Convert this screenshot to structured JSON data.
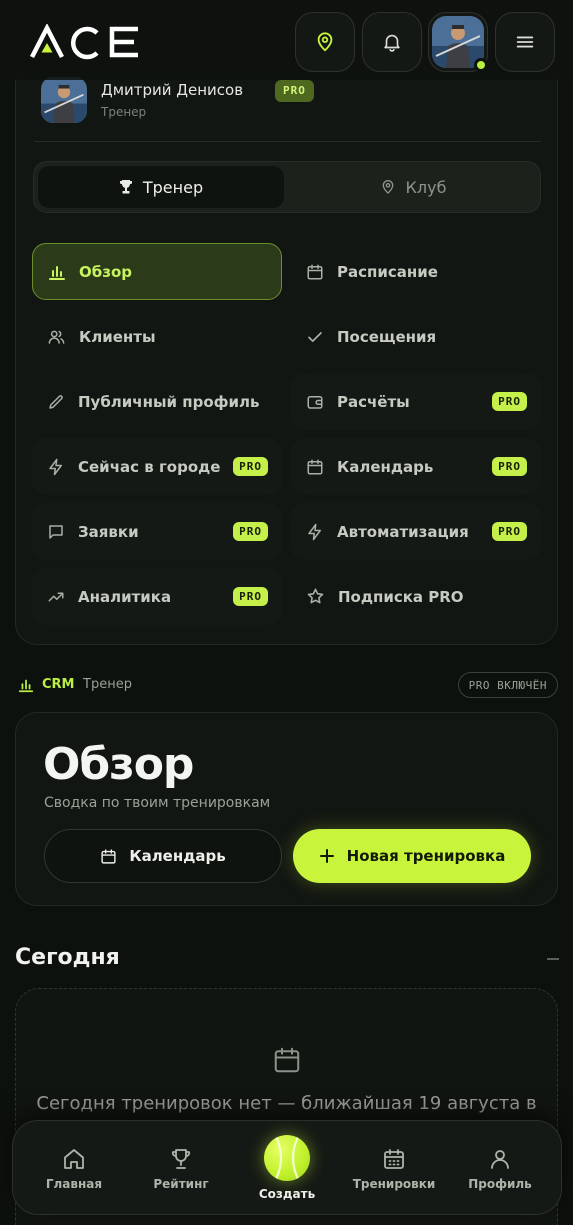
{
  "app": {
    "logo": "ACE"
  },
  "colors": {
    "accent": "#c8f53c",
    "background": "#0d110d",
    "card": "#121612"
  },
  "header": {
    "icons": [
      "location-icon",
      "bell-icon",
      "avatar",
      "menu-icon"
    ]
  },
  "profile": {
    "name": "Дмитрий Денисов",
    "badge": "PRO",
    "role": "Тренер"
  },
  "segment": {
    "trainer_label": "Тренер",
    "club_label": "Клуб"
  },
  "nav": {
    "overview": "Обзор",
    "schedule": "Расписание",
    "clients": "Клиенты",
    "visits": "Посещения",
    "public_profile": "Публичный профиль",
    "payments": "Расчёты",
    "city_now": "Сейчас в городе",
    "calendar": "Календарь",
    "requests": "Заявки",
    "automation": "Автоматизация",
    "analytics": "Аналитика",
    "subscription": "Подписка PRO",
    "pro": "PRO"
  },
  "crm": {
    "label": "CRM",
    "role": "Тренер",
    "pro_status": "PRO ВКЛЮЧЁН"
  },
  "overview": {
    "title": "Обзор",
    "subtitle": "Сводка по твоим тренировкам",
    "calendar_button": "Календарь",
    "new_button": "Новая тренировка"
  },
  "today": {
    "title": "Сегодня",
    "empty_text": "Сегодня тренировок нет — ближайшая 19 августа в"
  },
  "bottom_nav": {
    "home": "Главная",
    "rating": "Рейтинг",
    "create": "Создать",
    "trainings": "Тренировки",
    "profile": "Профиль"
  }
}
